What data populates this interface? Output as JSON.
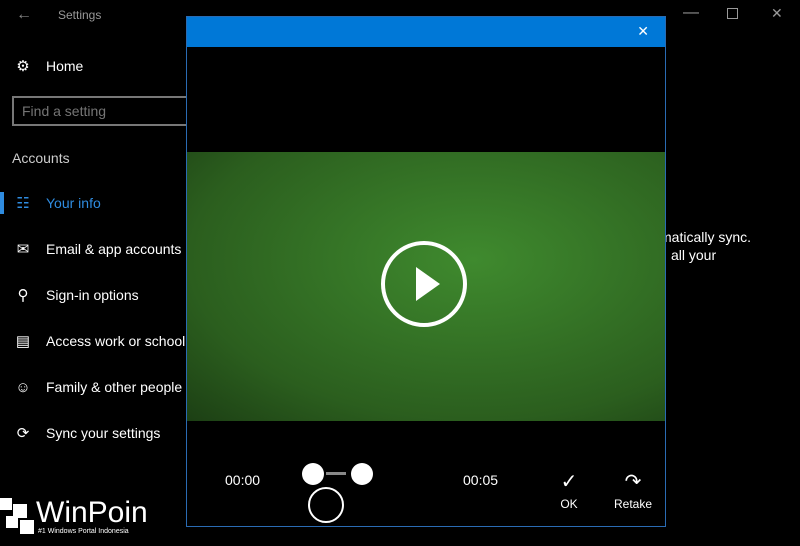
{
  "window": {
    "title": "Settings",
    "back_icon": "arrow-left-icon",
    "minimize_icon": "minimize-icon",
    "maximize_icon": "maximize-icon",
    "close_icon": "close-icon"
  },
  "sidebar": {
    "home": "Home",
    "search_placeholder": "Find a setting",
    "section": "Accounts",
    "items": [
      {
        "label": "Your info",
        "icon": "person-list-icon"
      },
      {
        "label": "Email & app accounts",
        "icon": "mail-icon"
      },
      {
        "label": "Sign-in options",
        "icon": "key-icon"
      },
      {
        "label": "Access work or school",
        "icon": "briefcase-icon"
      },
      {
        "label": "Family & other people",
        "icon": "person-add-icon"
      },
      {
        "label": "Sync your settings",
        "icon": "sync-icon"
      }
    ]
  },
  "content": {
    "line1": "matically sync.",
    "line2": "all your"
  },
  "camera": {
    "accent": "#0078d7",
    "start_time": "00:00",
    "end_time": "00:05",
    "ok": "OK",
    "retake": "Retake",
    "play_icon": "play-icon"
  },
  "watermark": {
    "brand": "WinPoin",
    "tagline": "#1 Windows Portal Indonesia"
  }
}
